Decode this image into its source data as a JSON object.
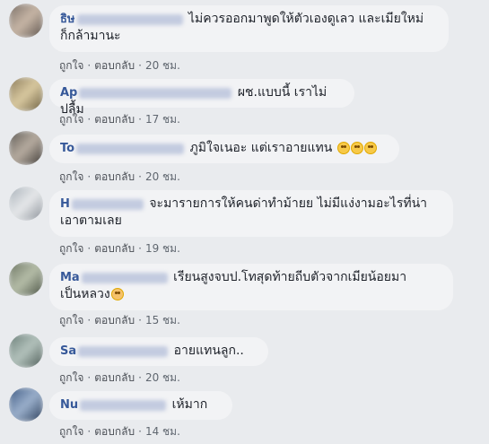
{
  "comments": [
    {
      "name_visible": "ธิษ",
      "text": "ไม่ควรออกมาพูดให้ตัวเองดูเลว และเมียใหม่",
      "text2": "ก็กล้ามานะ",
      "like": "ถูกใจ",
      "reply": "ตอบกลับ",
      "time": "20 ชม."
    },
    {
      "name_visible": "Ap",
      "text": "ผช.แบบนี้ เราไม่ปลื้ม",
      "like": "ถูกใจ",
      "reply": "ตอบกลับ",
      "time": "17 ชม."
    },
    {
      "name_visible": "To",
      "text": "ภูมิใจเนอะ แต่เราอายแทน",
      "emoji": [
        "flushed-emoji",
        "flushed-emoji",
        "flushed-emoji"
      ],
      "like": "ถูกใจ",
      "reply": "ตอบกลับ",
      "time": "20 ชม."
    },
    {
      "name_visible": "H",
      "text": "จะมารายการให้คนด่าทำม้ายย ไม่มีแง่งามอะไรที่น่า",
      "text2": "เอาตามเลย",
      "like": "ถูกใจ",
      "reply": "ตอบกลับ",
      "time": "19 ชม."
    },
    {
      "name_visible": "Ma",
      "text": "เรียนสูงจบป.โทสุดท้ายถีบตัวจากเมียน้อยมา",
      "text2": "เป็นหลวง",
      "emoji": [
        "sad-emoji"
      ],
      "like": "ถูกใจ",
      "reply": "ตอบกลับ",
      "time": "15 ชม."
    },
    {
      "name_visible": "Sa",
      "text": "อายแทนลูก..",
      "like": "ถูกใจ",
      "reply": "ตอบกลับ",
      "time": "20 ชม."
    },
    {
      "name_visible": "Nu",
      "text": "เห้มาก",
      "like": "ถูกใจ",
      "reply": "ตอบกลับ",
      "time": "14 ชม."
    }
  ],
  "colors": {
    "background": "#e9ebee",
    "bubble": "#f2f3f5",
    "name": "#365899",
    "meta": "#606770"
  }
}
